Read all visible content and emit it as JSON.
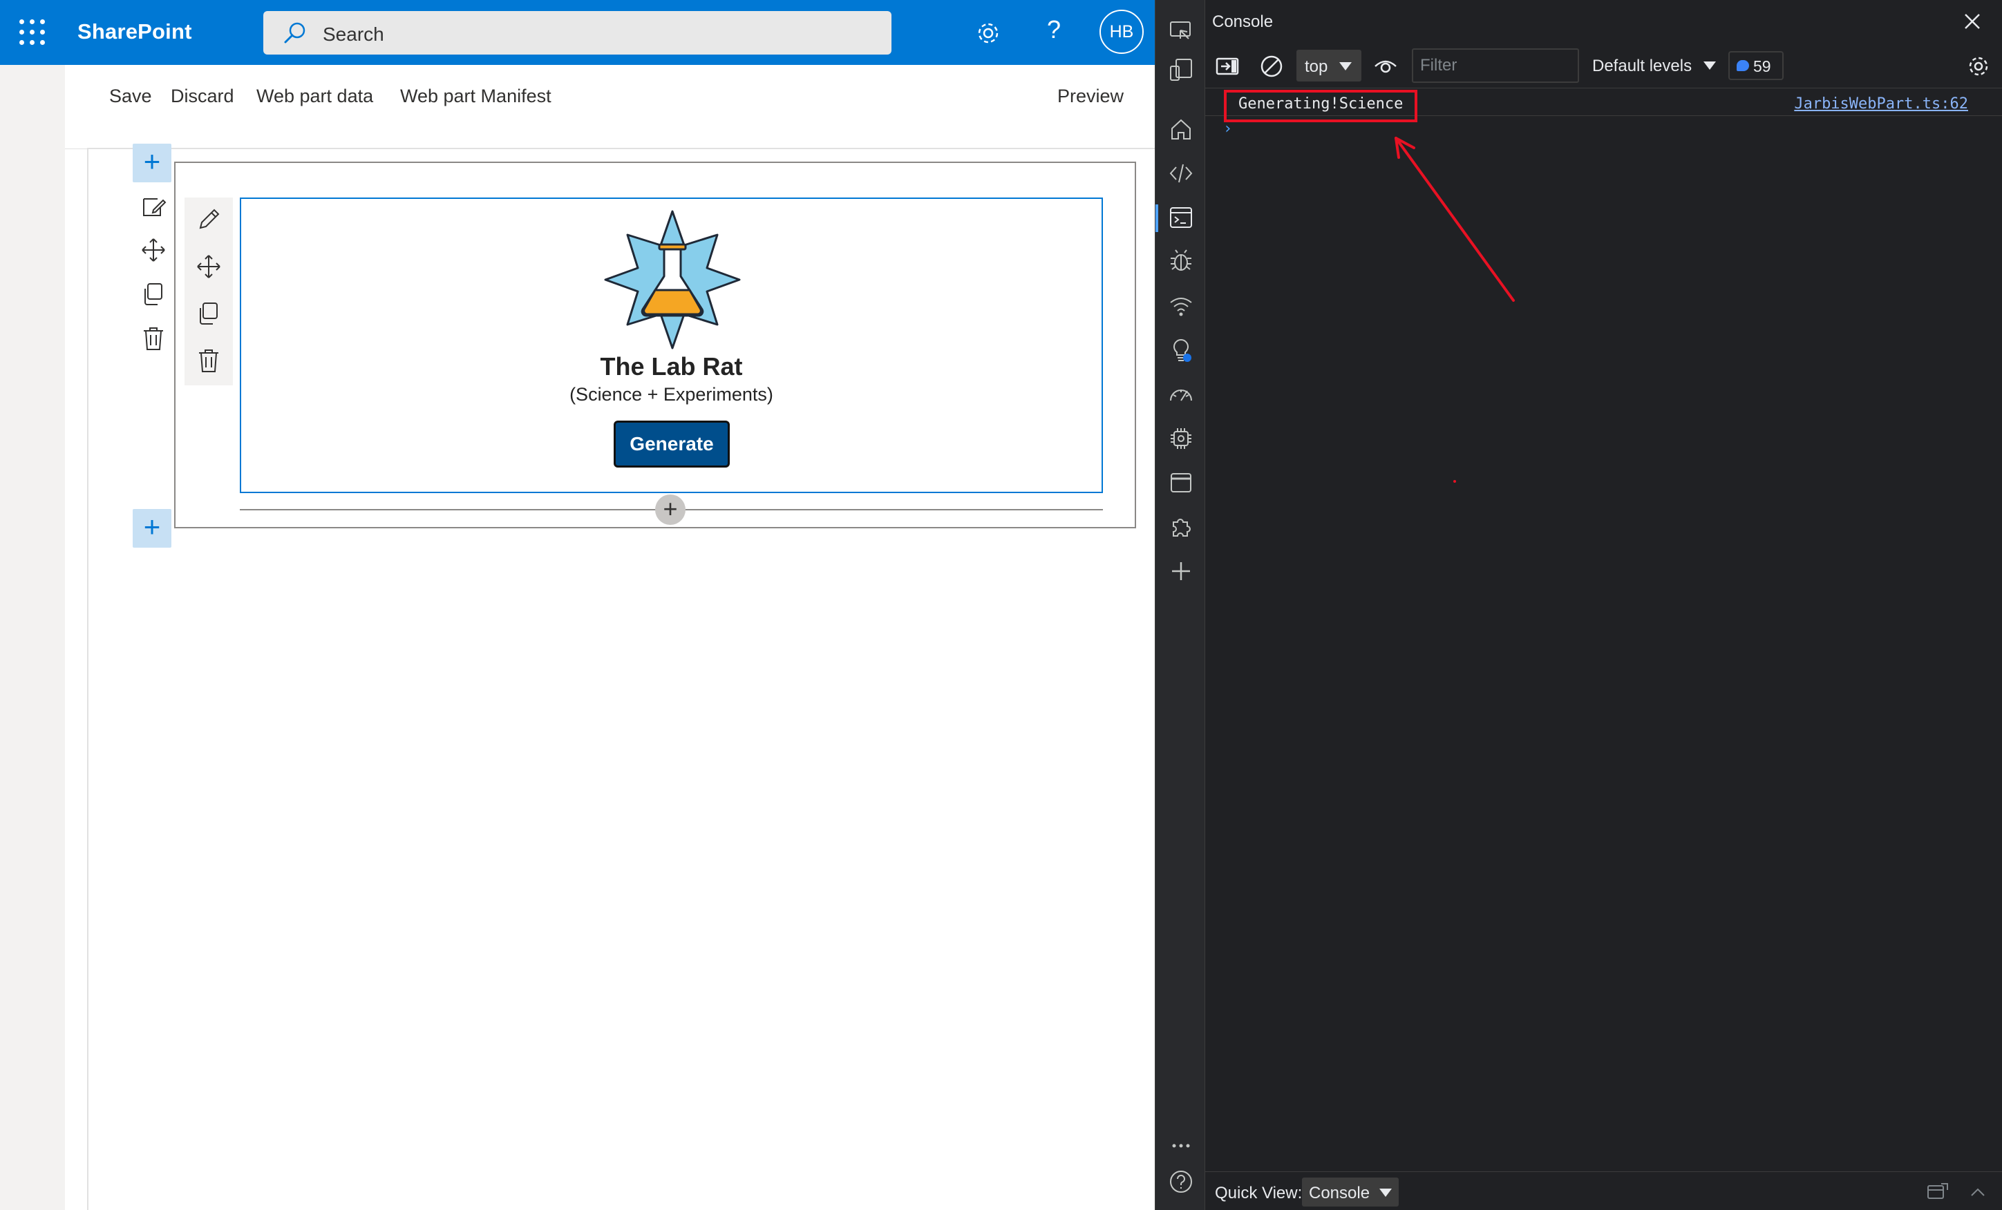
{
  "sharepoint": {
    "app_title": "SharePoint",
    "search_placeholder": "Search",
    "avatar_initials": "HB",
    "help_glyph": "?",
    "icons": [
      "waffle-icon",
      "search-icon",
      "settings-icon",
      "help-icon"
    ],
    "brand_color": "#0078d4"
  },
  "workbench": {
    "commands": {
      "save": "Save",
      "discard": "Discard",
      "web_part_data": "Web part data",
      "web_part_manifest": "Web part Manifest",
      "preview": "Preview"
    },
    "plus_glyph": "+"
  },
  "webpart": {
    "title": "The Lab Rat",
    "subtitle": "(Science + Experiments)",
    "button_label": "Generate",
    "logo": "flask-badge-icon",
    "colors": {
      "badge": "#87ceeb",
      "flask": "#f5a623",
      "button": "#004e8c"
    }
  },
  "devtools": {
    "panel_title": "Console",
    "context": "top",
    "filter_placeholder": "Filter",
    "levels_label": "Default levels",
    "issues_count": "59",
    "log": {
      "message": "Generating!Science",
      "source": "JarbisWebPart.ts:62"
    },
    "prompt": "›",
    "quick_view": {
      "label": "Quick View:",
      "value": "Console"
    },
    "activity_icons": [
      "home-icon",
      "elements-icon",
      "console-icon",
      "sources-debug-icon",
      "network-icon",
      "performance-insights-icon",
      "performance-icon",
      "memory-icon",
      "application-icon",
      "extensions-icon",
      "more-tools-icon",
      "more-icon",
      "help-icon"
    ],
    "highlight_color": "#e81123"
  }
}
